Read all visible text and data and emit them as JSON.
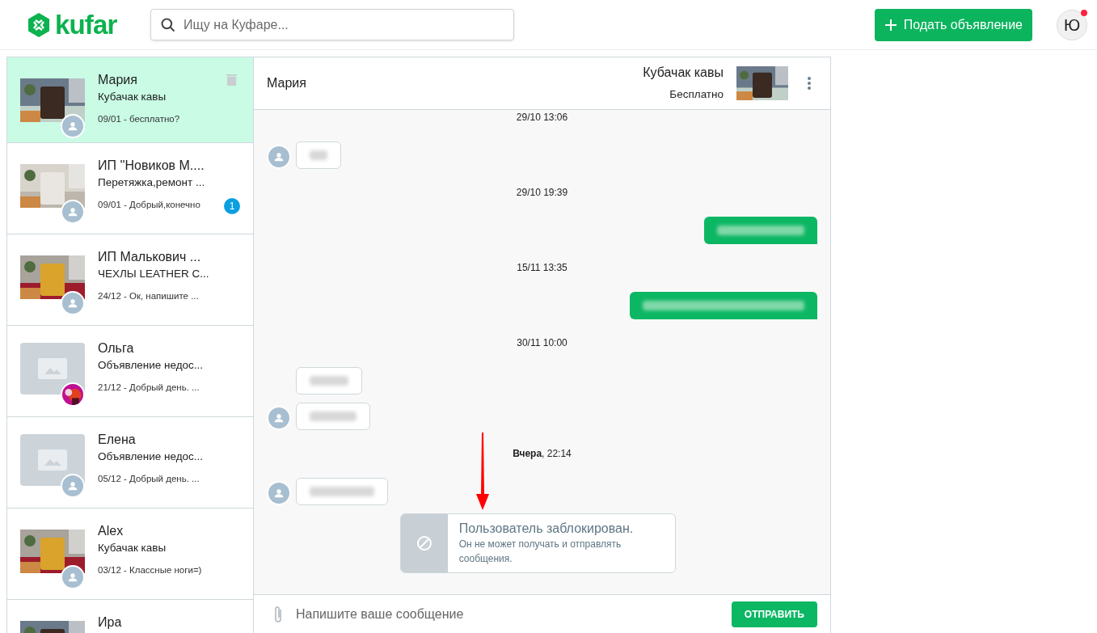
{
  "header": {
    "logo": "kufar",
    "search": {
      "placeholder": "Ищу на Куфаре..."
    },
    "post_button": "Подать объявление",
    "avatar": "Ю",
    "notification": true
  },
  "conversations": [
    {
      "name": "Мария",
      "item": "Кубачак кавы",
      "last": "09/01 - бесплатно?",
      "photo_thumb": true,
      "avatar_photo": false,
      "selected": true,
      "delete_icon": true
    },
    {
      "name": "ИП ''Новиков М....",
      "item": "Перетяжка,ремонт ...",
      "last": "09/01 - Добрый,конечно",
      "photo_thumb": true,
      "avatar_photo": false,
      "selected": false,
      "unread": "1",
      "delete_icon": false
    },
    {
      "name": "ИП Малькович ...",
      "item": "ЧЕХЛЫ LEATHER C...",
      "last": "24/12 - Ок, напишите ...",
      "photo_thumb": true,
      "avatar_photo": false,
      "selected": false,
      "delete_icon": false
    },
    {
      "name": "Ольга",
      "item": "Объявление недос...",
      "last": "21/12 - Добрый день. ...",
      "photo_thumb": false,
      "avatar_photo": true,
      "selected": false,
      "delete_icon": false
    },
    {
      "name": "Елена",
      "item": "Объявление недос...",
      "last": "05/12 - Добрый день. ...",
      "photo_thumb": false,
      "avatar_photo": false,
      "selected": false,
      "delete_icon": false
    },
    {
      "name": "Alex",
      "item": "Кубачак кавы",
      "last": "03/12 - Классные ноги=)",
      "photo_thumb": true,
      "avatar_photo": false,
      "selected": false,
      "delete_icon": false
    },
    {
      "name": "Ира",
      "photo_thumb": true,
      "selected": false,
      "delete_icon": false
    }
  ],
  "chat": {
    "contact": "Мария",
    "item_title": "Кубачак кавы",
    "price": "Бесплатно",
    "messages": [
      {
        "kind": "date",
        "text": "29/10 13:06"
      },
      {
        "kind": "in",
        "avatar": true
      },
      {
        "kind": "date",
        "text": "29/10 19:39"
      },
      {
        "kind": "out"
      },
      {
        "kind": "date",
        "text": "15/11 13:35"
      },
      {
        "kind": "out"
      },
      {
        "kind": "date",
        "text": "30/11 10:00"
      },
      {
        "kind": "in",
        "avatar": false
      },
      {
        "kind": "in",
        "avatar": true
      },
      {
        "kind": "date",
        "text": "**Вчера**, 22:14"
      },
      {
        "kind": "in",
        "avatar": true
      },
      {
        "kind": "blocked",
        "title": "Пользователь заблокирован.",
        "text": "Он не может получать и отправлять сообщения."
      }
    ],
    "input": {
      "placeholder": "Напишите ваше сообщение"
    },
    "send_button": "ОТПРАВИТЬ"
  }
}
